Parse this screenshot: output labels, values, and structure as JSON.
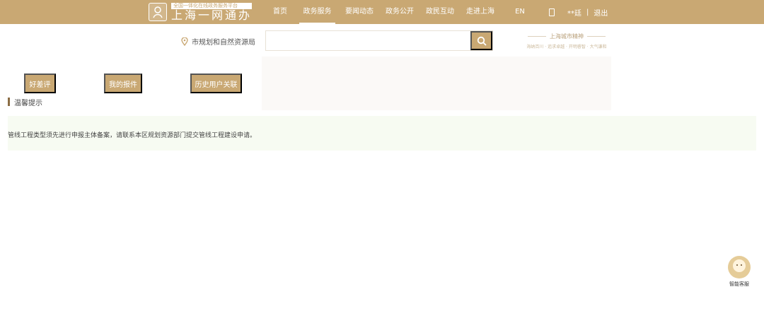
{
  "header": {
    "logo_subtitle": "全国一体化在线政务服务平台",
    "logo_title": "上海一网通办",
    "nav": [
      {
        "label": "首页"
      },
      {
        "label": "政务服务"
      },
      {
        "label": "要闻动态"
      },
      {
        "label": "政务公开"
      },
      {
        "label": "政民互动"
      },
      {
        "label": "走进上海"
      },
      {
        "label": "EN"
      }
    ],
    "user_name": "**廷",
    "separator": "|",
    "logout_label": "退出"
  },
  "search": {
    "location_label": "市规划和自然资源局",
    "placeholder": "",
    "value": ""
  },
  "brand": {
    "title": "上海城市精神",
    "tagline": "海纳百川 · 追求卓越 · 开明睿智 · 大气谦和"
  },
  "actions": {
    "rating_label": "好差评",
    "my_submissions_label": "我的报件",
    "history_link_label": "历史用户关联"
  },
  "notice": {
    "heading": "温馨提示",
    "message": "管线工程类型须先进行申报主体备案，请联系本区规划资源部门提交管线工程建设申请。"
  },
  "assistant": {
    "label": "智能客服"
  },
  "colors": {
    "accent_gold": "#c9a873",
    "notice_background": "#f7fbf2",
    "notice_bar": "#8b6d45"
  }
}
